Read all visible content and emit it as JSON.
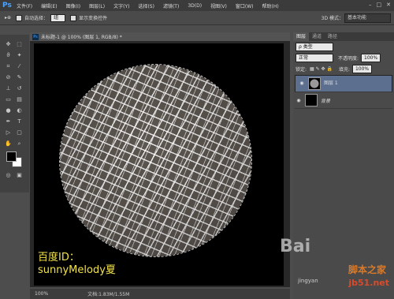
{
  "app": {
    "logo": "Ps"
  },
  "menu": [
    "文件(F)",
    "编辑(E)",
    "图像(I)",
    "图层(L)",
    "文字(Y)",
    "选择(S)",
    "滤镜(T)",
    "3D(D)",
    "视图(V)",
    "窗口(W)",
    "帮助(H)"
  ],
  "options": {
    "auto_select_label": "自动选择：",
    "auto_select_value": "组",
    "show_transform_label": "显示变换控件",
    "mode_3d": "3D 模式：",
    "workspace": "基本功能"
  },
  "document": {
    "tab_title": "未标题-1 @ 100% (图层 1, RGB/8) *"
  },
  "status": {
    "zoom": "100%",
    "doc_size": "文档:1.83M/1.55M"
  },
  "panel": {
    "tabs": [
      "图层",
      "通道",
      "路径"
    ],
    "kind_filter": "ρ 类型",
    "blend_mode": "正常",
    "opacity_label": "不透明度:",
    "opacity_value": "100%",
    "lock_label": "锁定:",
    "fill_label": "填充:",
    "fill_value": "100%",
    "layers": [
      {
        "name": "图层 1",
        "selected": true
      },
      {
        "name": "背景",
        "selected": false
      }
    ]
  },
  "watermark": {
    "line1": "百度ID：",
    "line2": "sunnyMelody夏",
    "baidu": "Bai",
    "site1": "脚本之家",
    "site2": "jb51.net",
    "jingyan": "jingyan"
  },
  "colors": {
    "accent_blue": "#4aa3ff",
    "watermark_yellow": "#f2e24a",
    "selected_layer": "#5c6f8f"
  }
}
